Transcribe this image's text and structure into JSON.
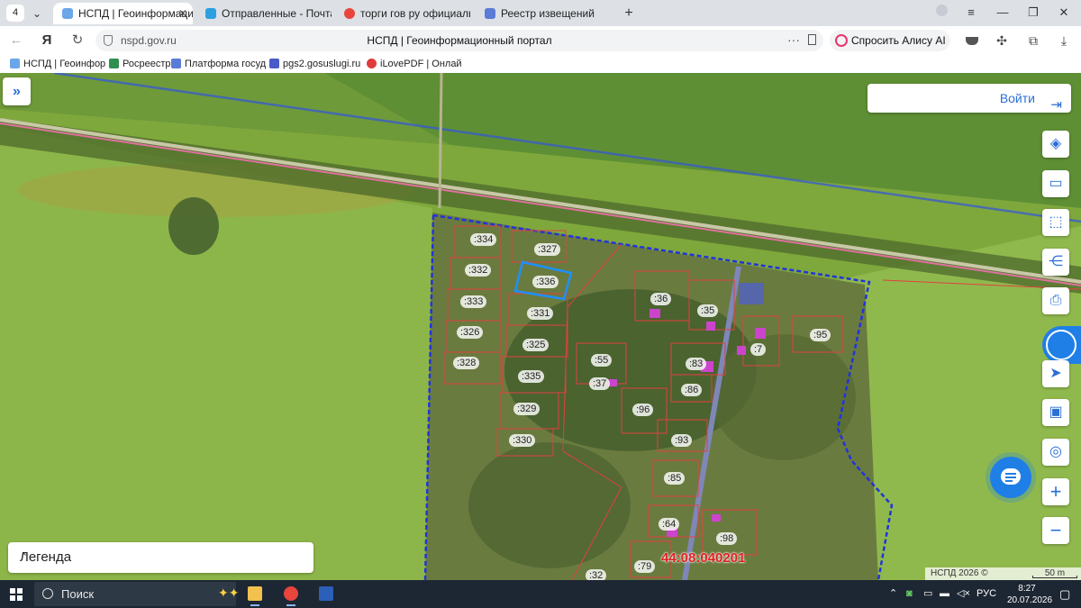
{
  "browser": {
    "tab_counter": "4",
    "tabs": [
      {
        "label": "НСПД | Геоинформаци",
        "active": true
      },
      {
        "label": "Отправленные - Почта",
        "active": false
      },
      {
        "label": "торги гов ру официальны",
        "active": false
      },
      {
        "label": "Реестр извещений",
        "active": false
      }
    ],
    "url": "nspd.gov.ru",
    "page_title": "НСПД | Геоинформационный портал",
    "alice_label": "Спросить Алису AI",
    "bookmarks": [
      "НСПД | Геоинфор",
      "Росреестр",
      "Платформа госуд",
      "pgs2.gosuslugi.ru",
      "iLovePDF | Онлай"
    ]
  },
  "map": {
    "login_label": "Войти",
    "legend_label": "Легенда",
    "attribution": "НСПД 2026 ©",
    "scale_label": "50 m",
    "quarter_number": "44:08:040201",
    "parcel_labels": [
      ":334",
      ":327",
      ":332",
      ":336",
      ":333",
      ":331",
      ":326",
      ":325",
      ":328",
      ":335",
      ":329",
      ":330",
      ":36",
      ":35",
      ":95",
      ":7",
      ":55",
      ":83",
      ":37",
      ":86",
      ":96",
      ":93",
      ":85",
      ":64",
      ":98",
      ":79",
      ":32"
    ],
    "selected_parcel": ":336",
    "colors": {
      "accent": "#2a6fd6",
      "parcel_border": "#e04040",
      "quarter_border": "#2233dd",
      "selected": "#1e90ff"
    }
  },
  "taskbar": {
    "search_label": "Поиск",
    "language": "РУС",
    "time": "8:27",
    "date": "20.07.2026"
  }
}
